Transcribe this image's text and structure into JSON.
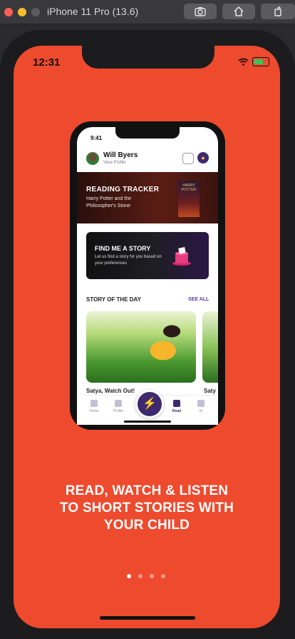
{
  "simulator": {
    "title": "iPhone 11 Pro (13.6)",
    "toolbar": {
      "screenshot_icon": "camera-icon",
      "home_icon": "home-icon",
      "rotate_icon": "rotate-icon"
    }
  },
  "status_bar": {
    "time": "12:31"
  },
  "mockup": {
    "status_time": "9:41",
    "profile": {
      "name": "Will Byers",
      "link": "View Profile"
    },
    "reading_tracker": {
      "title": "READING TRACKER",
      "book": "Harry Potter and the Philosopher's Stone",
      "cover_text": "HARRY POTTER"
    },
    "find_story": {
      "title": "FIND ME A STORY",
      "subtitle": "Let us find a story for you based on your preferences"
    },
    "story_of_the_day": {
      "title": "STORY OF THE DAY",
      "see_all": "SEE ALL",
      "items": [
        "Satya, Watch Out!",
        "Saty"
      ]
    },
    "tabs": [
      {
        "label": "Home",
        "icon": "home-icon"
      },
      {
        "label": "Profile",
        "icon": "profile-icon"
      },
      {
        "label": "Read",
        "icon": "book-icon"
      },
      {
        "label": "Di",
        "icon": "puzzle-icon"
      }
    ],
    "fab_icon": "lightning-icon"
  },
  "headline": {
    "line1": "READ, WATCH & LISTEN",
    "line2": "TO SHORT STORIES WITH",
    "line3": "YOUR CHILD"
  },
  "pager": {
    "count": 4,
    "active": 1
  },
  "colors": {
    "background": "#ee4a2e",
    "accent": "#3d2a6e",
    "fab_bolt": "#4ee0c9"
  }
}
